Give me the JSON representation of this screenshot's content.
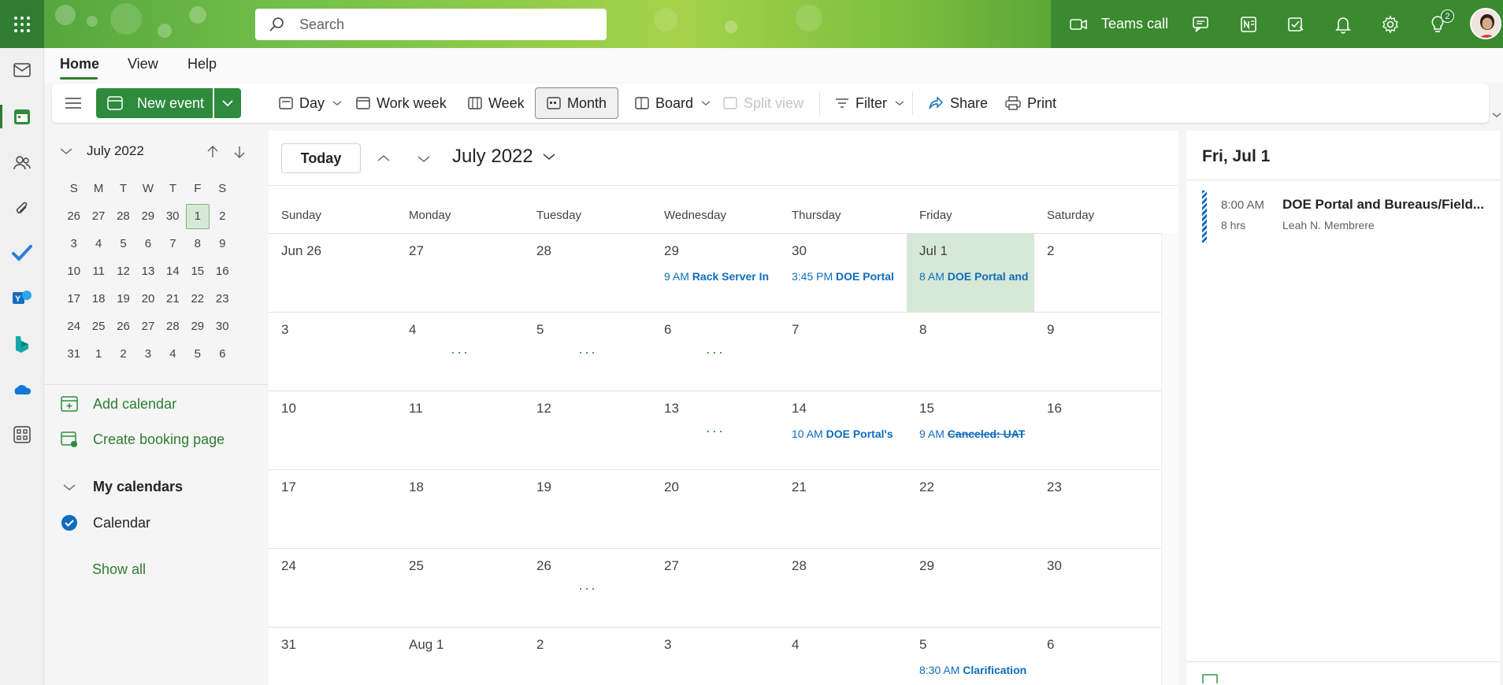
{
  "header": {
    "search_placeholder": "Search",
    "teams_call": "Teams call",
    "notification_count": "2"
  },
  "menu": {
    "tabs": [
      "Home",
      "View",
      "Help"
    ]
  },
  "ribbon": {
    "new_event": "New event",
    "day": "Day",
    "work_week": "Work week",
    "week": "Week",
    "month": "Month",
    "board": "Board",
    "split_view": "Split view",
    "filter": "Filter",
    "share": "Share",
    "print": "Print"
  },
  "mini_calendar": {
    "title": "July 2022",
    "weekdays": [
      "S",
      "M",
      "T",
      "W",
      "T",
      "F",
      "S"
    ],
    "weeks": [
      [
        "26",
        "27",
        "28",
        "29",
        "30",
        "1",
        "2"
      ],
      [
        "3",
        "4",
        "5",
        "6",
        "7",
        "8",
        "9"
      ],
      [
        "10",
        "11",
        "12",
        "13",
        "14",
        "15",
        "16"
      ],
      [
        "17",
        "18",
        "19",
        "20",
        "21",
        "22",
        "23"
      ],
      [
        "24",
        "25",
        "26",
        "27",
        "28",
        "29",
        "30"
      ],
      [
        "31",
        "1",
        "2",
        "3",
        "4",
        "5",
        "6"
      ]
    ],
    "selected": "1"
  },
  "left_links": {
    "add_calendar": "Add calendar",
    "create_booking": "Create booking page",
    "my_calendars": "My calendars",
    "calendar": "Calendar",
    "show_all": "Show all"
  },
  "month_view": {
    "today_button": "Today",
    "title": "July 2022",
    "weekdays": [
      "Sunday",
      "Monday",
      "Tuesday",
      "Wednesday",
      "Thursday",
      "Friday",
      "Saturday"
    ],
    "weeks": [
      [
        {
          "day": "Jun 26"
        },
        {
          "day": "27"
        },
        {
          "day": "28"
        },
        {
          "day": "29",
          "event_time": "9 AM",
          "event_title": "Rack Server In"
        },
        {
          "day": "30",
          "event_time": "3:45 PM",
          "event_title": "DOE Portal"
        },
        {
          "day": "Jul 1",
          "event_time": "8 AM",
          "event_title": "DOE Portal and",
          "today": true
        },
        {
          "day": "2"
        }
      ],
      [
        {
          "day": "3"
        },
        {
          "day": "4",
          "more": "···"
        },
        {
          "day": "5",
          "more": "···"
        },
        {
          "day": "6",
          "more": "···"
        },
        {
          "day": "7"
        },
        {
          "day": "8"
        },
        {
          "day": "9"
        }
      ],
      [
        {
          "day": "10"
        },
        {
          "day": "11"
        },
        {
          "day": "12"
        },
        {
          "day": "13",
          "more": "···"
        },
        {
          "day": "14",
          "event_time": "10 AM",
          "event_title": "DOE Portal's"
        },
        {
          "day": "15",
          "event_time": "9 AM",
          "event_title": "Canceled: UAT",
          "canceled": true
        },
        {
          "day": "16"
        }
      ],
      [
        {
          "day": "17"
        },
        {
          "day": "18"
        },
        {
          "day": "19"
        },
        {
          "day": "20"
        },
        {
          "day": "21"
        },
        {
          "day": "22"
        },
        {
          "day": "23"
        }
      ],
      [
        {
          "day": "24"
        },
        {
          "day": "25"
        },
        {
          "day": "26",
          "more": "···"
        },
        {
          "day": "27"
        },
        {
          "day": "28"
        },
        {
          "day": "29"
        },
        {
          "day": "30"
        }
      ],
      [
        {
          "day": "31"
        },
        {
          "day": "Aug 1"
        },
        {
          "day": "2"
        },
        {
          "day": "3"
        },
        {
          "day": "4"
        },
        {
          "day": "5",
          "event_time": "8:30 AM",
          "event_title": "Clarification"
        },
        {
          "day": "6"
        }
      ]
    ]
  },
  "day_pane": {
    "title": "Fri, Jul 1",
    "event": {
      "time": "8:00 AM",
      "duration": "8 hrs",
      "title": "DOE Portal and Bureaus/Field...",
      "organizer": "Leah N. Membrere"
    }
  },
  "colors": {
    "brand_green": "#2e8b3e",
    "event_blue": "#0f6cbd",
    "today_bg": "#d6e9d6"
  }
}
